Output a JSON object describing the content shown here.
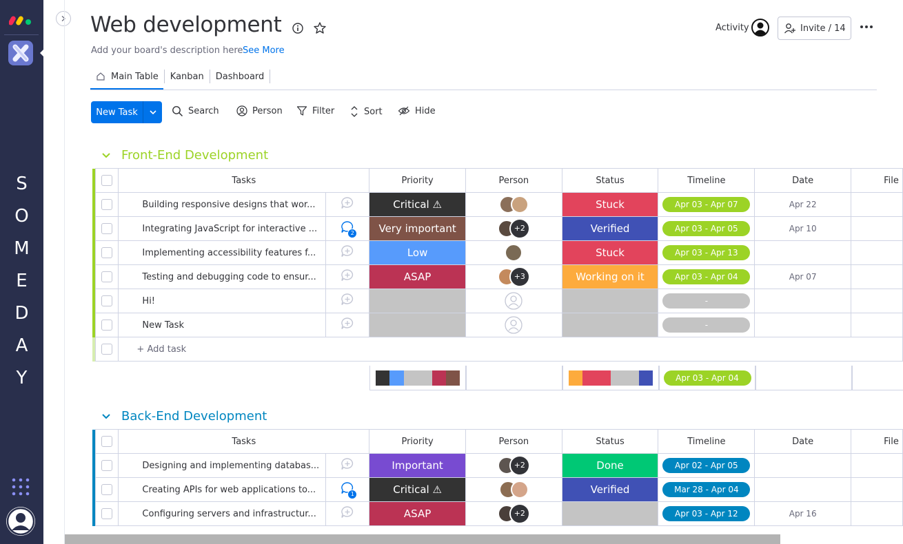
{
  "rail": {
    "workspace_letters": [
      "S",
      "O",
      "M",
      "E",
      "D",
      "A",
      "Y"
    ]
  },
  "header": {
    "title": "Web development",
    "description": "Add your board's description here",
    "see_more": "See More",
    "activity": "Activity",
    "invite": "Invite / 14"
  },
  "tabs": [
    {
      "label": "Main Table",
      "active": true
    },
    {
      "label": "Kanban",
      "active": false
    },
    {
      "label": "Dashboard",
      "active": false
    }
  ],
  "toolbar": {
    "new_task": "New Task",
    "search": "Search",
    "person": "Person",
    "filter": "Filter",
    "sort": "Sort",
    "hide": "Hide"
  },
  "columns": {
    "tasks": "Tasks",
    "priority": "Priority",
    "person": "Person",
    "status": "Status",
    "timeline": "Timeline",
    "date": "Date",
    "files": "File"
  },
  "groups": [
    {
      "name": "Front-End Development",
      "color": "#9cd326",
      "add_task": "+ Add task",
      "rows": [
        {
          "task": "Building responsive designs that wor...",
          "priority": "Critical ⚠",
          "priority_color": "#333333",
          "people": [
            "#8b6f5a",
            "#c9a27e"
          ],
          "more": "",
          "status": "Stuck",
          "status_color": "#e2445c",
          "timeline": "Apr 03 - Apr 07",
          "timeline_color": "#9cd326",
          "date": "Apr 22",
          "updates": ""
        },
        {
          "task": "Integrating JavaScript for interactive ...",
          "priority": "Very important",
          "priority_color": "#7f5347",
          "people": [
            "#5a4a3f"
          ],
          "more": "+2",
          "status": "Verified",
          "status_color": "#4051b5",
          "timeline": "Apr 03 - Apr 05",
          "timeline_color": "#9cd326",
          "date": "Apr 10",
          "updates": "2"
        },
        {
          "task": "Implementing accessibility features f...",
          "priority": "Low",
          "priority_color": "#579bfc",
          "people": [
            "#7a6a55"
          ],
          "more": "",
          "status": "Stuck",
          "status_color": "#e2445c",
          "timeline": "Apr 03 - Apr 13",
          "timeline_color": "#9cd326",
          "date": "",
          "updates": ""
        },
        {
          "task": "Testing and debugging code to ensur...",
          "priority": "ASAP",
          "priority_color": "#bb3354",
          "people": [
            "#c48a5d"
          ],
          "more": "+3",
          "status": "Working on it",
          "status_color": "#fdab3d",
          "timeline": "Apr 03 - Apr 04",
          "timeline_color": "#9cd326",
          "date": "Apr 07",
          "updates": ""
        },
        {
          "task": "Hi!",
          "priority": "",
          "priority_color": "#c4c4c4",
          "people": [],
          "more": "",
          "status": "",
          "status_color": "#c4c4c4",
          "timeline": "-",
          "timeline_color": "#c4c4c4",
          "date": "",
          "updates": ""
        },
        {
          "task": "New Task",
          "priority": "",
          "priority_color": "#c4c4c4",
          "people": [],
          "more": "",
          "status": "",
          "status_color": "#c4c4c4",
          "timeline": "-",
          "timeline_color": "#c4c4c4",
          "date": "",
          "updates": ""
        }
      ],
      "summary": {
        "priority_segments": [
          {
            "color": "#333333",
            "share": 0.167
          },
          {
            "color": "#579bfc",
            "share": 0.167
          },
          {
            "color": "#c4c4c4",
            "share": 0.333
          },
          {
            "color": "#bb3354",
            "share": 0.167
          },
          {
            "color": "#7f5347",
            "share": 0.166
          }
        ],
        "status_segments": [
          {
            "color": "#fdab3d",
            "share": 0.167
          },
          {
            "color": "#e2445c",
            "share": 0.333
          },
          {
            "color": "#c4c4c4",
            "share": 0.333
          },
          {
            "color": "#4051b5",
            "share": 0.167
          }
        ],
        "timeline": "Apr 03 - Apr 04",
        "timeline_color": "#9cd326"
      }
    },
    {
      "name": "Back-End Development",
      "color": "#0086c0",
      "rows": [
        {
          "task": "Designing and implementing databas...",
          "priority": "Important",
          "priority_color": "#784bd1",
          "people": [
            "#5d5550"
          ],
          "more": "+2",
          "status": "Done",
          "status_color": "#00c875",
          "timeline": "Apr 02 - Apr 05",
          "timeline_color": "#0086c0",
          "date": "",
          "updates": ""
        },
        {
          "task": "Creating APIs for web applications to...",
          "priority": "Critical ⚠",
          "priority_color": "#333333",
          "people": [
            "#8c6d52",
            "#d4a58a"
          ],
          "more": "",
          "status": "Verified",
          "status_color": "#4051b5",
          "timeline": "Mar 28 - Apr 04",
          "timeline_color": "#0086c0",
          "date": "",
          "updates": "1"
        },
        {
          "task": "Configuring servers and infrastructur...",
          "priority": "ASAP",
          "priority_color": "#bb3354",
          "people": [
            "#4a3f3a"
          ],
          "more": "+2",
          "status": "",
          "status_color": "#c4c4c4",
          "timeline": "Apr 03 - Apr 12",
          "timeline_color": "#0086c0",
          "date": "Apr 16",
          "updates": ""
        }
      ]
    }
  ]
}
